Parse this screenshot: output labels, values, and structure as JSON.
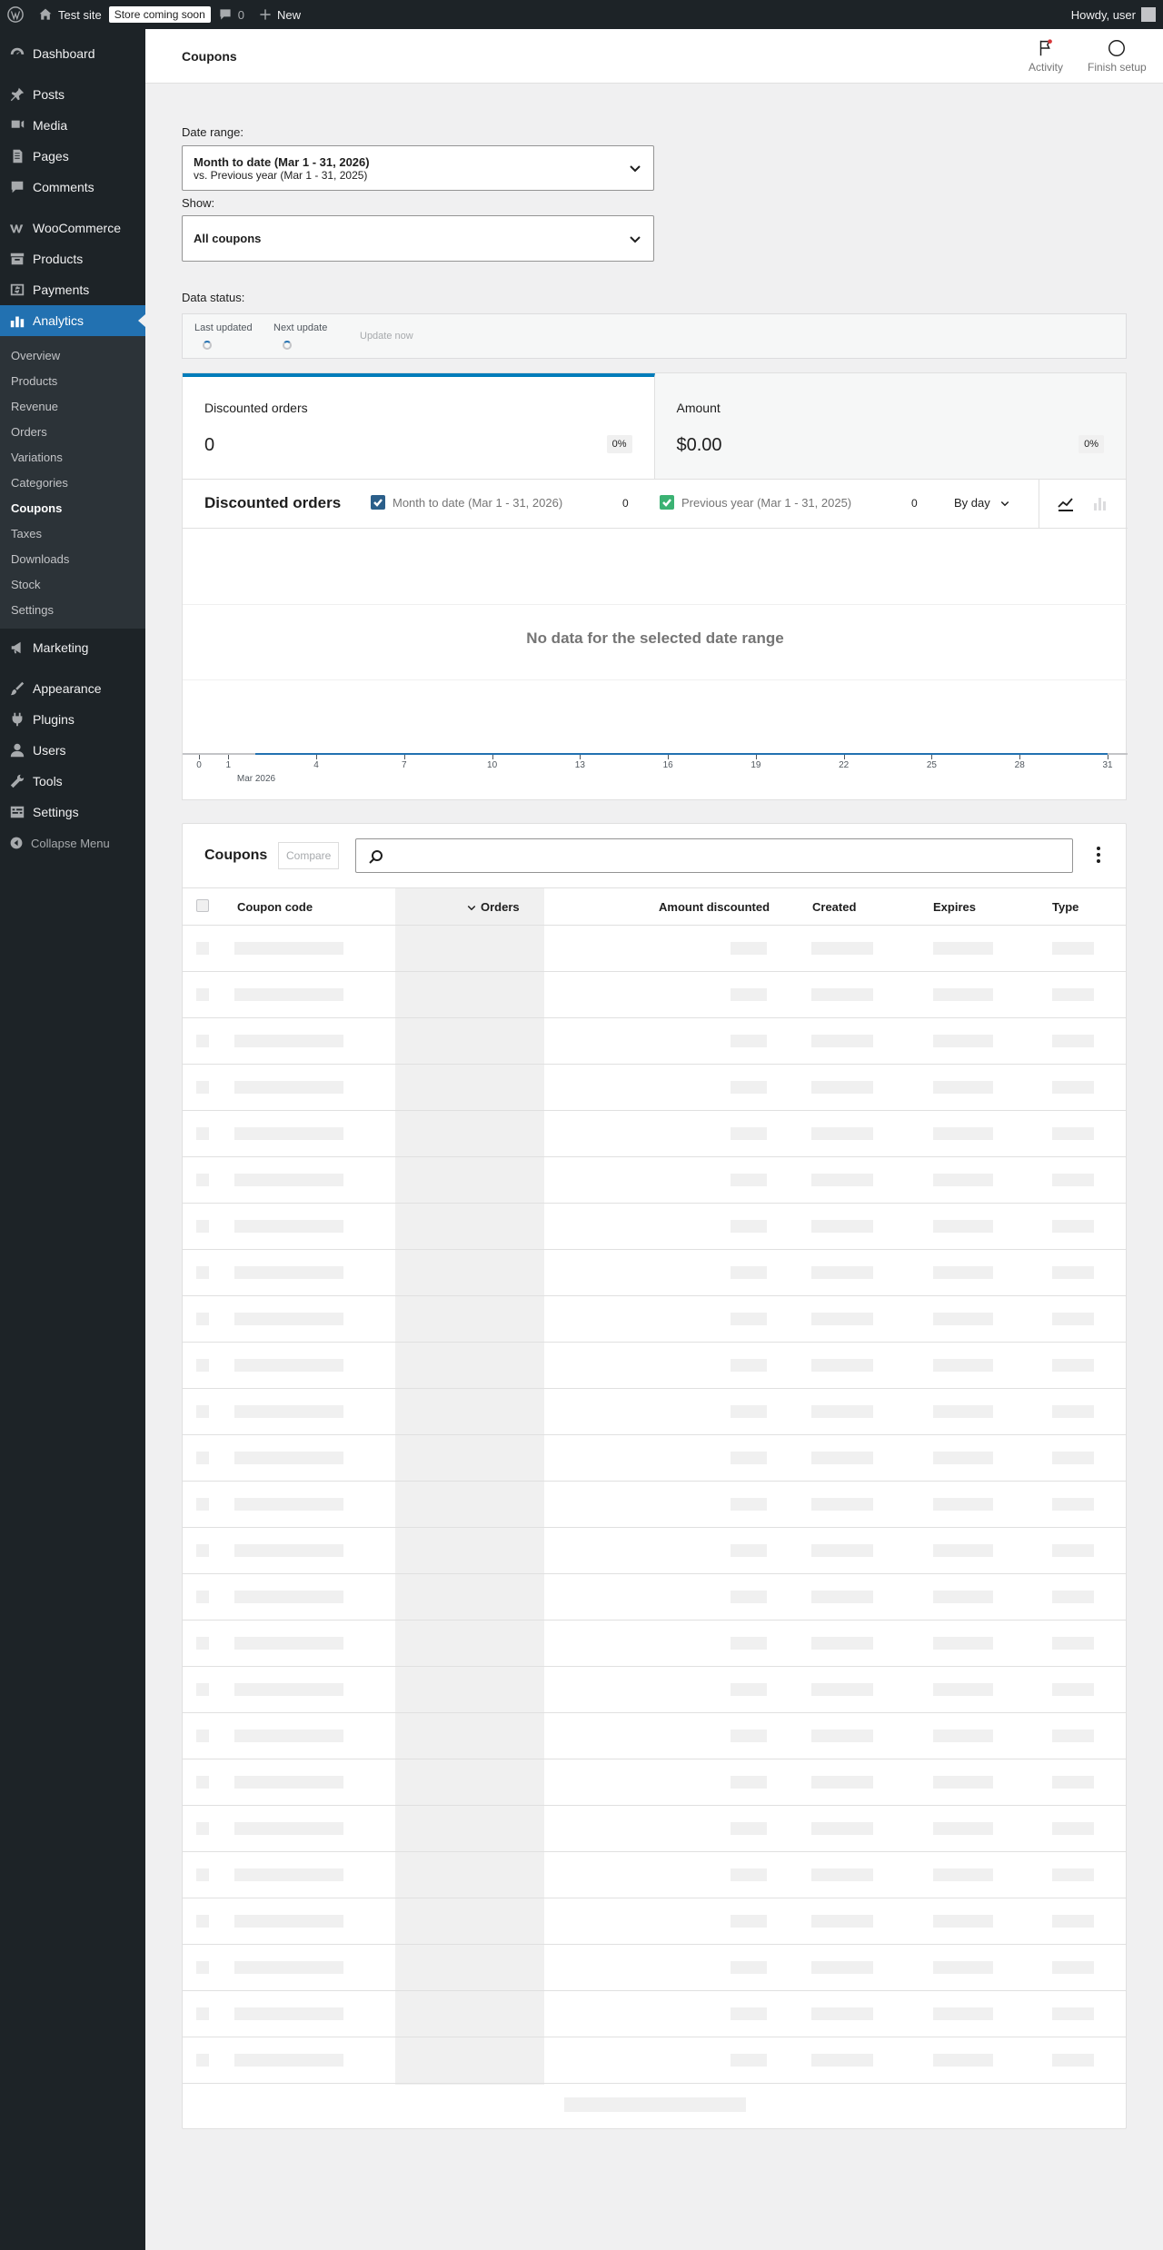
{
  "adminbar": {
    "site_name": "Test site",
    "store_badge": "Store coming soon",
    "comments_count": "0",
    "new_label": "New",
    "howdy": "Howdy, user"
  },
  "sidebar": {
    "items": [
      {
        "label": "Dashboard",
        "icon": "dashboard-icon"
      },
      {
        "label": "Posts",
        "icon": "pin-icon"
      },
      {
        "label": "Media",
        "icon": "media-icon"
      },
      {
        "label": "Pages",
        "icon": "pages-icon"
      },
      {
        "label": "Comments",
        "icon": "comment-icon"
      },
      {
        "label": "WooCommerce",
        "icon": "woo-icon"
      },
      {
        "label": "Products",
        "icon": "archive-icon"
      },
      {
        "label": "Payments",
        "icon": "dollar-icon"
      },
      {
        "label": "Analytics",
        "icon": "chart-bar-icon"
      },
      {
        "label": "Marketing",
        "icon": "megaphone-icon"
      },
      {
        "label": "Appearance",
        "icon": "brush-icon"
      },
      {
        "label": "Plugins",
        "icon": "plug-icon"
      },
      {
        "label": "Users",
        "icon": "user-icon"
      },
      {
        "label": "Tools",
        "icon": "wrench-icon"
      },
      {
        "label": "Settings",
        "icon": "settings-icon"
      }
    ],
    "submenu": [
      "Overview",
      "Products",
      "Revenue",
      "Orders",
      "Variations",
      "Categories",
      "Coupons",
      "Taxes",
      "Downloads",
      "Stock",
      "Settings"
    ],
    "collapse_label": "Collapse Menu"
  },
  "header": {
    "title": "Coupons",
    "activity_label": "Activity",
    "finish_setup_label": "Finish setup"
  },
  "filters": {
    "date_range_label": "Date range:",
    "date_range_primary": "Month to date (Mar 1 - 31, 2026)",
    "date_range_secondary": "vs. Previous year (Mar 1 - 31, 2025)",
    "show_label": "Show:",
    "show_value": "All coupons"
  },
  "data_status": {
    "label": "Data status:",
    "last_updated": "Last updated",
    "next_update": "Next update",
    "update_now": "Update now"
  },
  "summary": [
    {
      "label": "Discounted orders",
      "value": "0",
      "delta": "0%"
    },
    {
      "label": "Amount",
      "value": "$0.00",
      "delta": "0%"
    }
  ],
  "chart": {
    "title": "Discounted orders",
    "legend": [
      {
        "label": "Month to date (Mar 1 - 31, 2026)",
        "value": "0",
        "color": "#2b5f8a"
      },
      {
        "label": "Previous year (Mar 1 - 31, 2025)",
        "value": "0",
        "color": "#3bb273"
      }
    ],
    "interval": "By day",
    "empty_message": "No data for the selected date range"
  },
  "chart_data": {
    "type": "line",
    "title": "Discounted orders",
    "x": [
      0,
      1,
      4,
      7,
      10,
      13,
      16,
      19,
      22,
      25,
      28,
      31
    ],
    "x_ticks": [
      "0",
      "1",
      "4",
      "7",
      "10",
      "13",
      "16",
      "19",
      "22",
      "25",
      "28",
      "31"
    ],
    "x_sublabel": "Mar 2026",
    "series": [
      {
        "name": "Month to date (Mar 1 - 31, 2026)",
        "values": []
      },
      {
        "name": "Previous year (Mar 1 - 31, 2025)",
        "values": []
      }
    ],
    "grid": true
  },
  "table": {
    "title": "Coupons",
    "compare_label": "Compare",
    "search_placeholder": "",
    "columns": [
      "Coupon code",
      "Orders",
      "Amount discounted",
      "Created",
      "Expires",
      "Type"
    ],
    "placeholder_rows": 25
  },
  "colors": {
    "accent": "#2271b1",
    "sidebar_bg": "#1d2327",
    "series_primary": "#2b5f8a",
    "series_secondary": "#3bb273"
  }
}
